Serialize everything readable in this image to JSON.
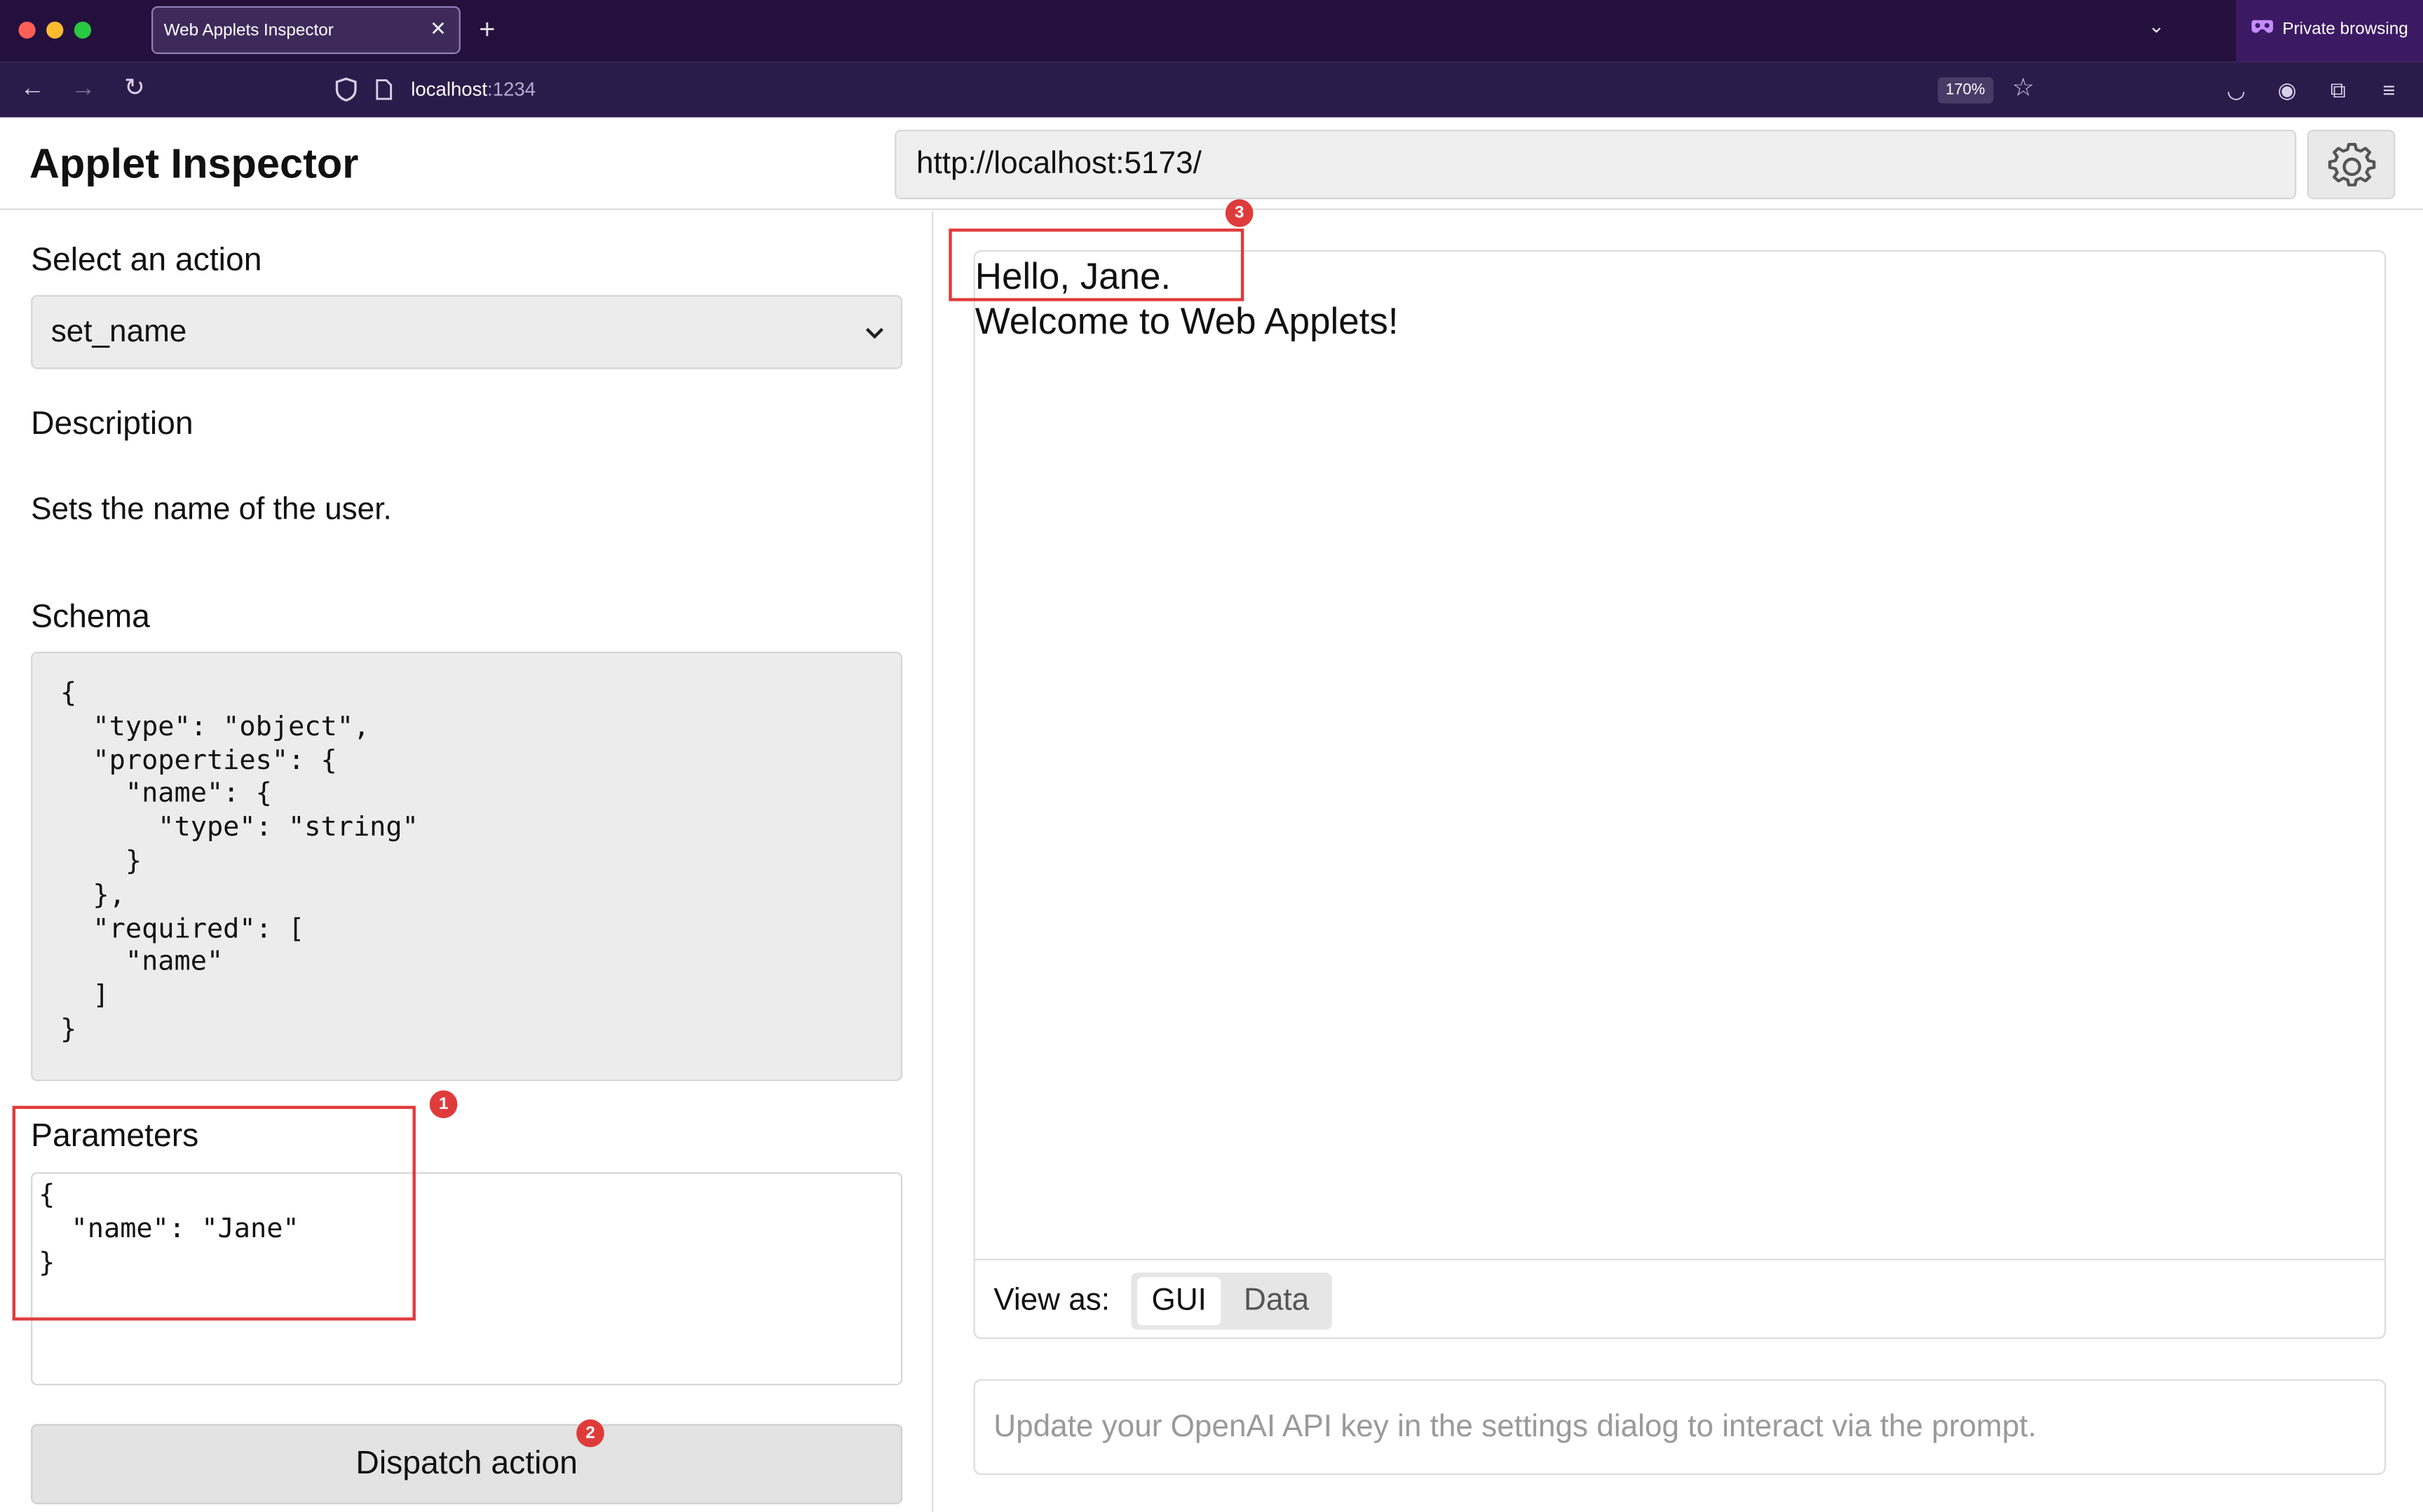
{
  "browser": {
    "tab_title": "Web Applets Inspector",
    "tab_close": "✕",
    "new_tab": "+",
    "private_label": "Private browsing",
    "url_host": "localhost",
    "url_port": ":1234",
    "zoom": "170%"
  },
  "app": {
    "title": "Applet Inspector",
    "applet_url": "http://localhost:5173/"
  },
  "left": {
    "select_heading": "Select an action",
    "selected_action": "set_name",
    "description_heading": "Description",
    "description": "Sets the name of the user.",
    "schema_heading": "Schema",
    "schema_code": "{\n  \"type\": \"object\",\n  \"properties\": {\n    \"name\": {\n      \"type\": \"string\"\n    }\n  },\n  \"required\": [\n    \"name\"\n  ]\n}",
    "parameters_heading": "Parameters",
    "parameters_code": "{\n  \"name\": \"Jane\"\n}",
    "dispatch_label": "Dispatch action"
  },
  "right": {
    "greeting": "Hello, Jane.",
    "welcome": "Welcome to Web Applets!",
    "view_as_label": "View as:",
    "view_gui": "GUI",
    "view_data": "Data",
    "prompt_placeholder": "Update your OpenAI API key in the settings dialog to interact via the prompt."
  },
  "annotations": {
    "badge_1": "1",
    "badge_2": "2",
    "badge_3": "3",
    "color": "#e03b3b"
  }
}
